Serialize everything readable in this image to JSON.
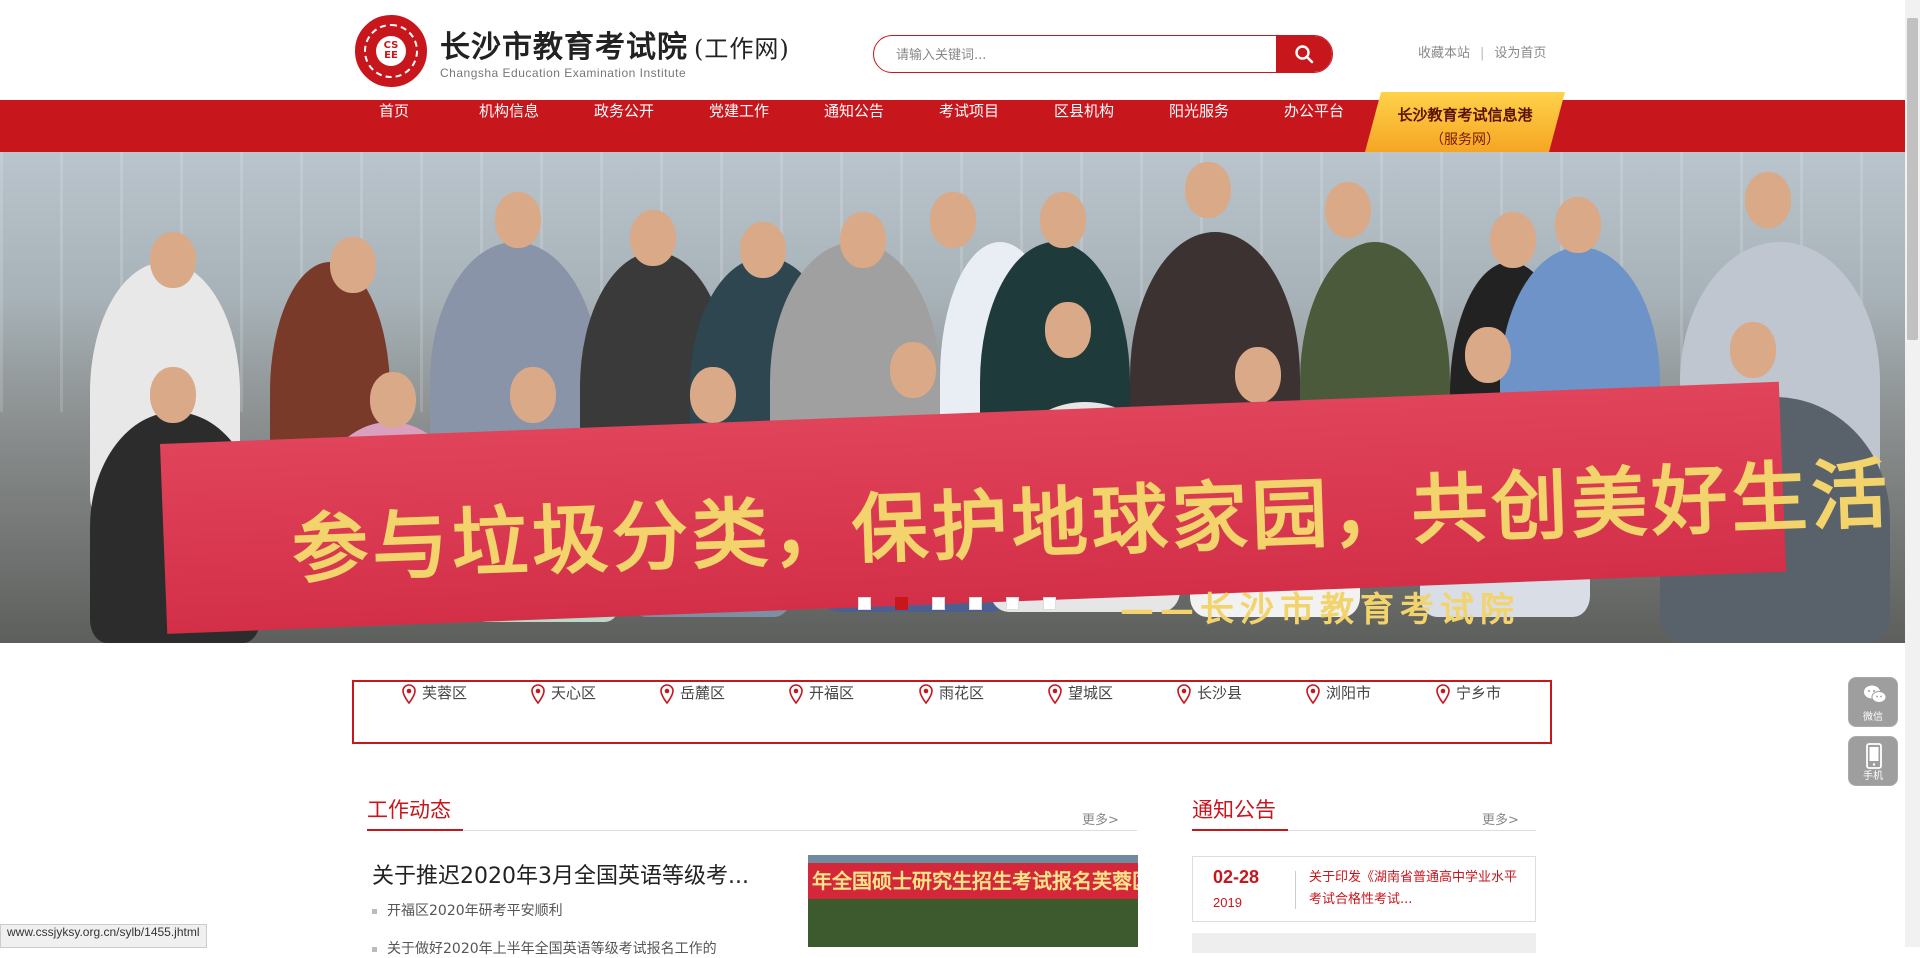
{
  "header": {
    "logo_mark": "CS EE",
    "title": "长沙市教育考试院",
    "title_sub": "(工作网)",
    "subtitle_en": "Changsha Education Examination Institute",
    "search_placeholder": "请输入关键词...",
    "search_icon": "search-icon",
    "links": [
      "收藏本站",
      "设为首页"
    ],
    "link_separator": "|"
  },
  "nav": {
    "items": [
      "首页",
      "机构信息",
      "政务公开",
      "党建工作",
      "通知公告",
      "考试项目",
      "区县机构",
      "阳光服务",
      "办公平台"
    ],
    "special_line1": "长沙教育考试信息港",
    "special_line2": "（服务网）",
    "bg_color": "#c8161d",
    "special_color": "#f8b62b"
  },
  "banner": {
    "slogan": "参与垃圾分类，保护地球家园，共创美好生活",
    "sign": "——长沙市教育考试院",
    "slide_count": 6,
    "active_slide": 2
  },
  "districts": [
    "芙蓉区",
    "天心区",
    "岳麓区",
    "开福区",
    "雨花区",
    "望城区",
    "长沙县",
    "浏阳市",
    "宁乡市"
  ],
  "work_news": {
    "title": "工作动态",
    "more": "更多>",
    "headline": "关于推迟2020年3月全国英语等级考...",
    "items": [
      "开福区2020年研考平安顺利",
      "关于做好2020年上半年全国英语等级考试报名工作的"
    ],
    "image_caption": "年全国硕士研究生招生考试报名芙蓉区现场确认"
  },
  "notices": {
    "title": "通知公告",
    "more": "更多>",
    "items": [
      {
        "date": "02-28",
        "year": "2019",
        "text": "关于印发《湖南省普通高中学业水平考试合格性考试..."
      }
    ]
  },
  "float": {
    "wechat_label": "微信",
    "mobile_label": "手机"
  },
  "status_bar": "www.cssjyksy.org.cn/sylb/1455.jhtml"
}
